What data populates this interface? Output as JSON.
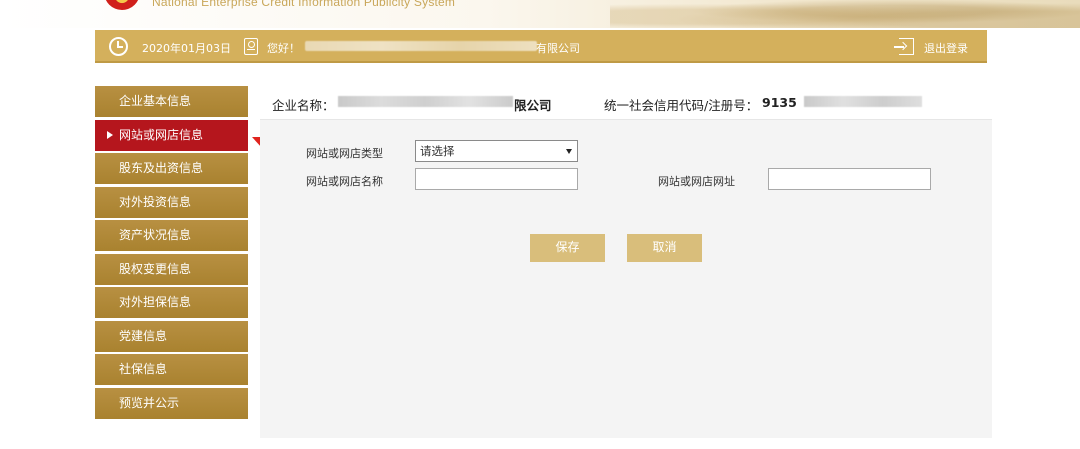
{
  "banner": {
    "english_title": "National Enterprise Credit Information Publicity System"
  },
  "infobar": {
    "date": "2020年01月03日",
    "greeting": "您好！",
    "company_suffix": "有限公司",
    "logout_label": "退出登录"
  },
  "sidebar": {
    "items": [
      {
        "label": "企业基本信息",
        "active": false
      },
      {
        "label": "网站或网店信息",
        "active": true
      },
      {
        "label": "股东及出资信息",
        "active": false
      },
      {
        "label": "对外投资信息",
        "active": false
      },
      {
        "label": "资产状况信息",
        "active": false
      },
      {
        "label": "股权变更信息",
        "active": false
      },
      {
        "label": "对外担保信息",
        "active": false
      },
      {
        "label": "党建信息",
        "active": false
      },
      {
        "label": "社保信息",
        "active": false
      },
      {
        "label": "预览并公示",
        "active": false
      }
    ]
  },
  "main": {
    "company_label": "企业名称：",
    "company_suffix": "限公司",
    "code_label": "统一社会信用代码/注册号：",
    "code_prefix": "9135",
    "form": {
      "type_label": "网站或网店类型",
      "type_select_value": "请选择",
      "name_label": "网站或网店名称",
      "url_label": "网站或网店网址",
      "name_value": "",
      "url_value": ""
    },
    "buttons": {
      "save": "保存",
      "cancel": "取消"
    }
  },
  "colors": {
    "gold_bar": "#d4b05c",
    "sidebar_gold": "#b08a3a",
    "sidebar_active_red": "#b5161d",
    "button_gold": "#d9be7b",
    "annotation_arrow": "#e0241e"
  }
}
